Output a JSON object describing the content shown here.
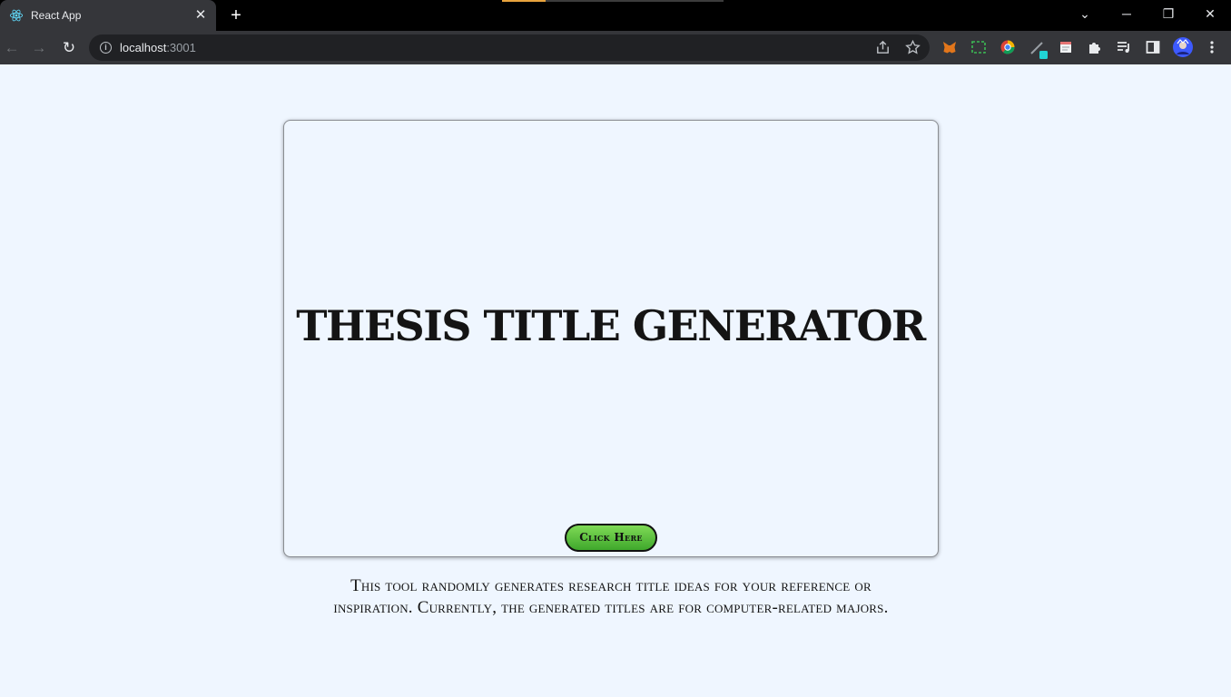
{
  "browser": {
    "tab_title": "React App",
    "tab_close": "✕",
    "new_tab": "+",
    "url_host": "localhost",
    "url_port": ":3001",
    "window_controls": {
      "menu": "⌄",
      "minimize": "─",
      "restore": "❐",
      "close": "✕"
    },
    "nav": {
      "back": "←",
      "forward": "→",
      "reload": "↻"
    },
    "omnibox_icons": [
      "share-icon",
      "bookmark-star-icon"
    ],
    "extension_icons": [
      "metamask-fox-icon",
      "screenshot-capture-icon",
      "color-picker-icon",
      "pen-tool-icon",
      "notes-icon",
      "puzzle-extensions-icon",
      "media-queue-icon",
      "side-panel-icon",
      "profile-avatar-icon",
      "kebab-menu-icon"
    ]
  },
  "app": {
    "headline": "THESIS TITLE GENERATOR",
    "button_label": "Click Here",
    "button_color": "#5cc440",
    "description": "This tool randomly generates research title ideas for your reference or inspiration. Currently, the generated titles are for computer-related majors."
  }
}
